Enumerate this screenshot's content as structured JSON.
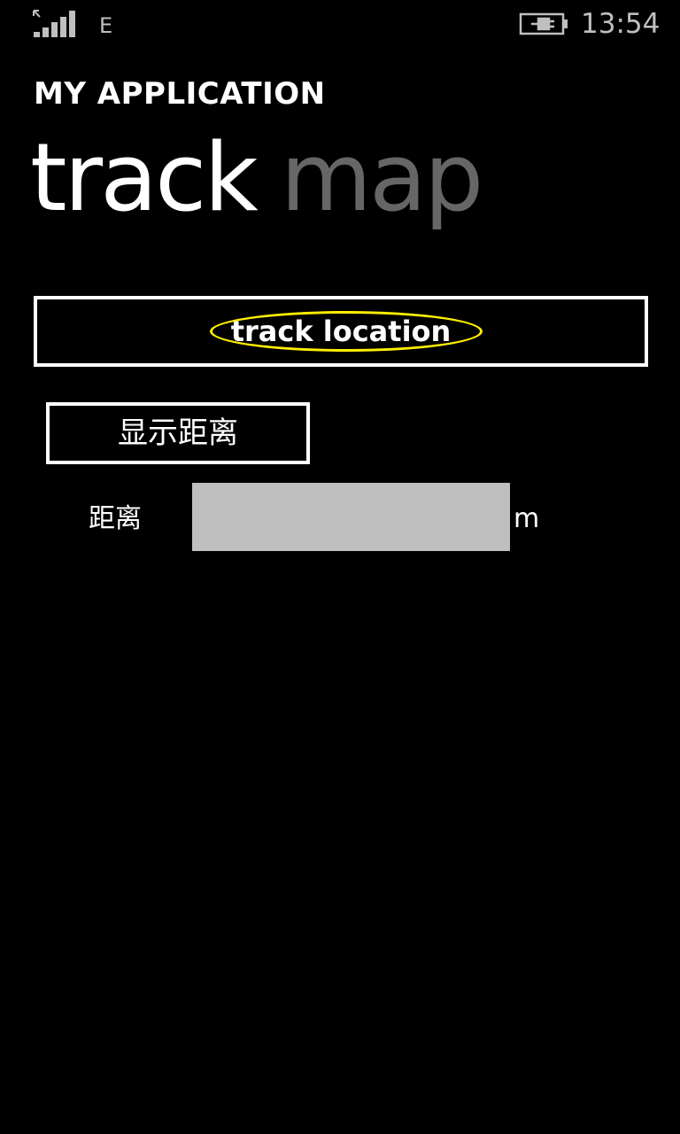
{
  "status_bar": {
    "signal_icon": "signal-strength-icon",
    "network_type": "E",
    "battery_icon": "battery-charging-icon",
    "time": "13:54"
  },
  "app": {
    "title": "MY APPLICATION"
  },
  "pivot": {
    "active_tab": "track",
    "inactive_tab": "map"
  },
  "controls": {
    "track_button_label": "track location",
    "highlight_color": "#ffee00",
    "show_distance_button_label": "显示距离",
    "distance_label": "距离",
    "distance_value": "",
    "distance_unit": "m"
  }
}
